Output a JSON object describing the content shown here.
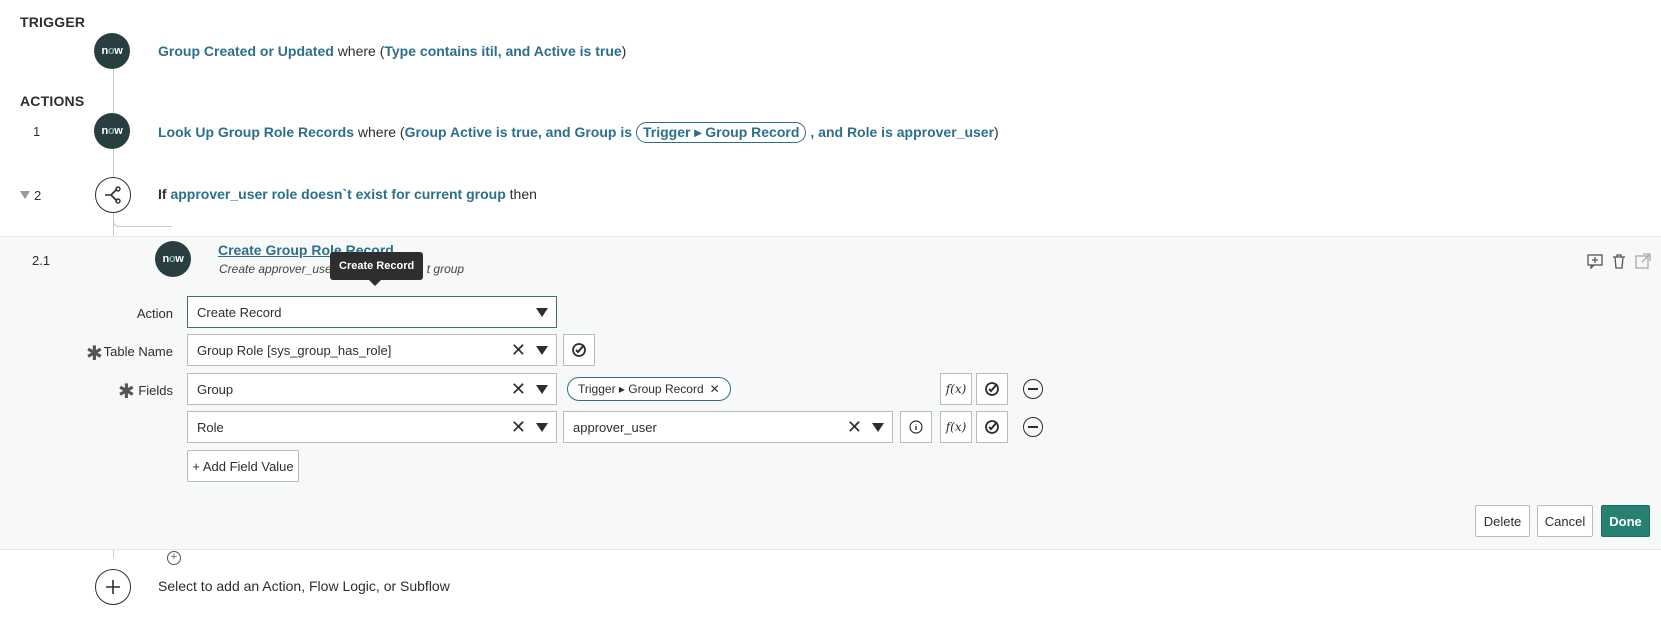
{
  "labels": {
    "trigger": "TRIGGER",
    "actions": "ACTIONS"
  },
  "trigger": {
    "logo": "now",
    "name": "Group Created or Updated",
    "where": "where (",
    "cond": "Type contains itil, and Active is true",
    "close": ")"
  },
  "step1": {
    "num": "1",
    "name": "Look Up Group Role Records",
    "where": "where (",
    "cond1": "Group Active is true, and Group is",
    "pill": "Trigger ▸ Group Record",
    "cond2": ", and Role is approver_user",
    "close": ")"
  },
  "step2": {
    "num": "2",
    "if": "If",
    "cond": "approver_user role doesn`t exist for current group",
    "then": "then"
  },
  "step21": {
    "num": "2.1",
    "title": "Create Group Role Record",
    "subtitle_a": "Create approver_use",
    "subtitle_b": "t group",
    "tooltip": "Create Record",
    "form": {
      "action_label": "Action",
      "action_value": "Create Record",
      "table_label": "Table Name",
      "table_value": "Group Role [sys_group_has_role]",
      "fields_label": "Fields",
      "field1_name": "Group",
      "field1_value": "Trigger ▸ Group Record",
      "field2_name": "Role",
      "field2_value": "approver_user",
      "add_field": "+ Add Field Value",
      "fx": "f(x)"
    },
    "buttons": {
      "delete": "Delete",
      "cancel": "Cancel",
      "done": "Done"
    }
  },
  "add": {
    "text": "Select to add an Action, Flow Logic, or Subflow"
  },
  "colors": {
    "accent": "#2d6f8a",
    "primary": "#278172",
    "logo_bg": "#293e40"
  }
}
